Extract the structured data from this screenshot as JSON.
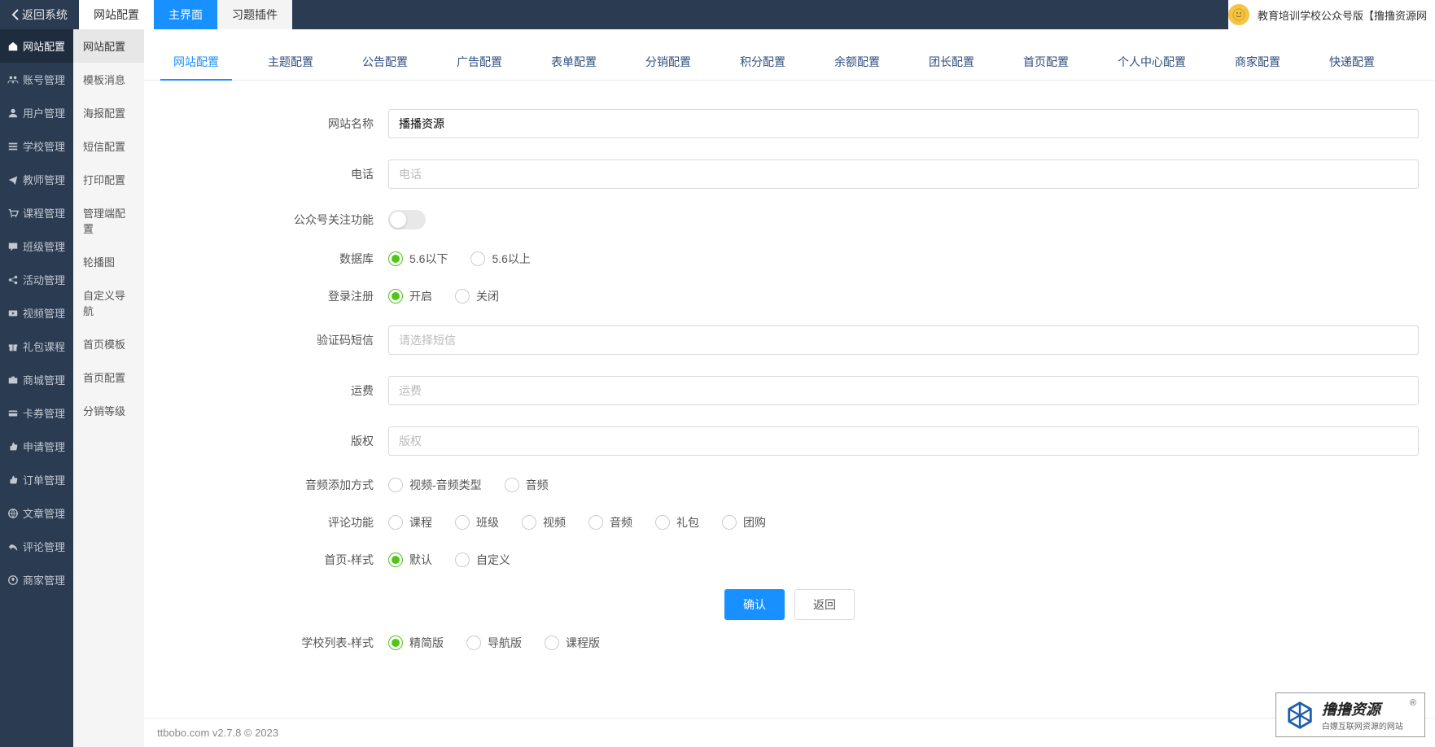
{
  "topbar": {
    "back": "返回系统",
    "tabs": [
      "网站配置",
      "主界面",
      "习题插件"
    ],
    "brand": "教育培训学校公众号版【撸撸资源网"
  },
  "sidebar_l1": [
    {
      "label": "网站配置",
      "icon": "home"
    },
    {
      "label": "账号管理",
      "icon": "users"
    },
    {
      "label": "用户管理",
      "icon": "user"
    },
    {
      "label": "学校管理",
      "icon": "bars"
    },
    {
      "label": "教师管理",
      "icon": "plane"
    },
    {
      "label": "课程管理",
      "icon": "cart"
    },
    {
      "label": "班级管理",
      "icon": "chat"
    },
    {
      "label": "活动管理",
      "icon": "share"
    },
    {
      "label": "视频管理",
      "icon": "video"
    },
    {
      "label": "礼包课程",
      "icon": "gift"
    },
    {
      "label": "商城管理",
      "icon": "briefcase"
    },
    {
      "label": "卡券管理",
      "icon": "card"
    },
    {
      "label": "申请管理",
      "icon": "thumb"
    },
    {
      "label": "订单管理",
      "icon": "thumb"
    },
    {
      "label": "文章管理",
      "icon": "globe"
    },
    {
      "label": "评论管理",
      "icon": "reply"
    },
    {
      "label": "商家管理",
      "icon": "soccer"
    }
  ],
  "sidebar_l2": [
    "网站配置",
    "模板消息",
    "海报配置",
    "短信配置",
    "打印配置",
    "管理端配置",
    "轮播图",
    "自定义导航",
    "首页模板",
    "首页配置",
    "分销等级"
  ],
  "content_tabs": [
    "网站配置",
    "主题配置",
    "公告配置",
    "广告配置",
    "表单配置",
    "分销配置",
    "积分配置",
    "余额配置",
    "团长配置",
    "首页配置",
    "个人中心配置",
    "商家配置",
    "快递配置"
  ],
  "form": {
    "site_name": {
      "label": "网站名称",
      "value": "播播资源"
    },
    "phone": {
      "label": "电话",
      "placeholder": "电话"
    },
    "follow": {
      "label": "公众号关注功能"
    },
    "database": {
      "label": "数据库",
      "options": [
        "5.6以下",
        "5.6以上"
      ],
      "selected": 0
    },
    "login_register": {
      "label": "登录注册",
      "options": [
        "开启",
        "关闭"
      ],
      "selected": 0
    },
    "sms": {
      "label": "验证码短信",
      "placeholder": "请选择短信"
    },
    "shipping": {
      "label": "运费",
      "placeholder": "运费"
    },
    "copyright": {
      "label": "版权",
      "placeholder": "版权"
    },
    "audio_add": {
      "label": "音频添加方式",
      "options": [
        "视频-音频类型",
        "音频"
      ],
      "selected": -1
    },
    "comment": {
      "label": "评论功能",
      "options": [
        "课程",
        "班级",
        "视频",
        "音频",
        "礼包",
        "团购"
      ],
      "selected": -1
    },
    "home_style": {
      "label": "首页-样式",
      "options": [
        "默认",
        "自定义"
      ],
      "selected": 0
    },
    "school_list_style": {
      "label": "学校列表-样式",
      "options": [
        "精简版",
        "导航版",
        "课程版"
      ],
      "selected": 0
    }
  },
  "actions": {
    "confirm": "确认",
    "back": "返回"
  },
  "footer": "ttbobo.com v2.7.8 © 2023",
  "watermark": {
    "title": "撸撸资源",
    "sub": "白嫖互联网资源的网站"
  }
}
